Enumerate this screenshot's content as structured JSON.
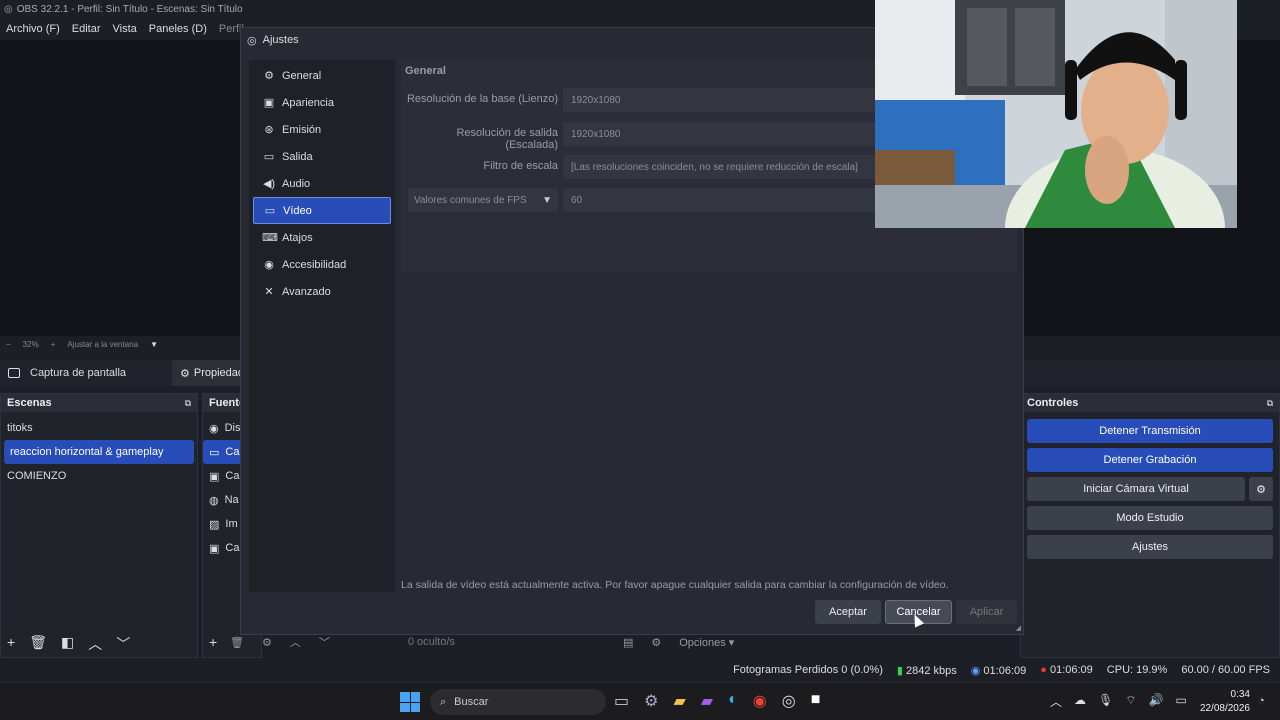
{
  "window": {
    "title": "OBS 32.2.1 - Perfil: Sin Título - Escenas: Sin Título"
  },
  "menu": [
    "Archivo (F)",
    "Editar",
    "Vista",
    "Paneles (D)",
    "Perfil"
  ],
  "zoom": {
    "minus": "−",
    "value": "32%",
    "plus": "+",
    "fit": "Ajustar a la ventana"
  },
  "sourcebar": {
    "label": "Captura de pantalla",
    "props": "Propiedades"
  },
  "scenes": {
    "title": "Escenas",
    "items": [
      "titoks",
      "reaccion horizontal & gameplay",
      "COMIENZO"
    ],
    "selected": 1
  },
  "sources": {
    "title": "Fuentes",
    "items": [
      "Dis",
      "Ca",
      "Ca",
      "Na",
      "Im",
      "Ca"
    ],
    "hidden": "0 oculto/s",
    "options": "Opciones"
  },
  "controls": {
    "title": "Controles",
    "buttons": [
      "Detener Transmisión",
      "Detener Grabación",
      "Iniciar Cámara Virtual",
      "Modo Estudio",
      "Ajustes"
    ]
  },
  "status": {
    "dropped": "Fotogramas Perdidos 0 (0.0%)",
    "kbps": "2842 kbps",
    "stream_time": "01:06:09",
    "rec_time": "01:06:09",
    "cpu": "CPU: 19.9%",
    "fps": "60.00 / 60.00 FPS"
  },
  "dialog": {
    "title": "Ajustes",
    "nav": [
      {
        "label": "General",
        "icon": "gear-icon"
      },
      {
        "label": "Apariencia",
        "icon": "palette-icon"
      },
      {
        "label": "Emisión",
        "icon": "broadcast-icon"
      },
      {
        "label": "Salida",
        "icon": "output-icon"
      },
      {
        "label": "Audio",
        "icon": "speaker-icon"
      },
      {
        "label": "Vídeo",
        "icon": "monitor-icon"
      },
      {
        "label": "Atajos",
        "icon": "keyboard-icon"
      },
      {
        "label": "Accesibilidad",
        "icon": "accessibility-icon"
      },
      {
        "label": "Avanzado",
        "icon": "tools-icon"
      }
    ],
    "selected_nav": 5,
    "section": "General",
    "base_label": "Resolución de la base (Lienzo)",
    "base_value": "1920x1080",
    "output_label": "Resolución de salida (Escalada)",
    "output_value": "1920x1080",
    "filter_label": "Filtro de escala",
    "filter_value": "[Las resoluciones coinciden, no se requiere reducción de escala]",
    "fps_select": "Valores comunes de FPS",
    "fps_value": "60",
    "note": "La salida de vídeo está actualmente activa. Por favor apague cualquier salida para cambiar la configuración de vídeo.",
    "ok": "Aceptar",
    "cancel": "Cancelar",
    "apply": "Aplicar"
  },
  "taskbar": {
    "search": "Buscar",
    "time": "0:34",
    "date": "22/08/2026"
  },
  "colors": {
    "accent": "#284cb8",
    "bg": "#1d1f26",
    "panel": "#272a33"
  }
}
